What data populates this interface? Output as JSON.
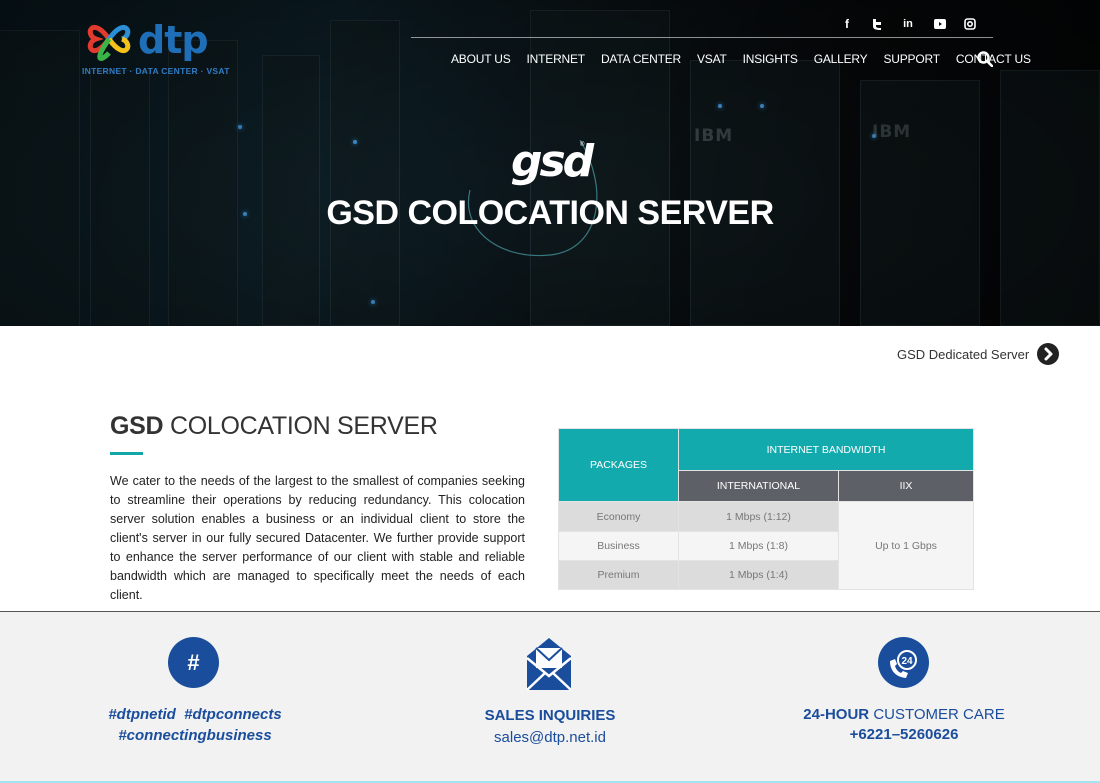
{
  "brand": {
    "logo_text": "dtp",
    "tagline": "INTERNET · DATA CENTER · VSAT",
    "colors": {
      "logo_blue": "#1f6fb8",
      "accent_teal": "#13a7a7",
      "footer_blue": "#1a4d9c"
    }
  },
  "social": [
    "facebook-icon",
    "twitter-icon",
    "linkedin-icon",
    "youtube-icon",
    "instagram-icon"
  ],
  "nav": {
    "items": [
      "ABOUT US",
      "INTERNET",
      "DATA CENTER",
      "VSAT",
      "INSIGHTS",
      "GALLERY",
      "SUPPORT",
      "CONTACT US"
    ],
    "search_icon": "search-icon"
  },
  "hero": {
    "product_logo": "gsd",
    "title": "GSD COLOCATION SERVER"
  },
  "subnav": {
    "next_label": "GSD Dedicated Server"
  },
  "section": {
    "title_bold": "GSD",
    "title_rest": "COLOCATION SERVER",
    "body": "We cater to the needs of the largest to the smallest of companies seeking to streamline their operations by reducing redundancy. This colocation server solution enables a business or an individual client to store the client's server in our fully secured Datacenter. We further provide support to enhance the server performance of our client with stable and reliable bandwidth which are managed to specifically meet the needs of each client."
  },
  "table": {
    "packages_header": "PACKAGES",
    "bandwidth_header": "INTERNET BANDWIDTH",
    "international_header": "INTERNATIONAL",
    "iix_header": "IIX",
    "rows": [
      {
        "package": "Economy",
        "international": "1 Mbps (1:12)"
      },
      {
        "package": "Business",
        "international": "1 Mbps (1:8)"
      },
      {
        "package": "Premium",
        "international": "1 Mbps (1:4)"
      }
    ],
    "iix_value": "Up to 1 Gbps"
  },
  "footer": {
    "hashtag_symbol": "#",
    "hashtags_line1": "#dtpnetid  #dtpconnects",
    "hashtags_line2": "#connectingbusiness",
    "sales_title": "SALES INQUIRIES",
    "sales_email": "sales@dtp.net.id",
    "care_bold": "24-HOUR",
    "care_rest": "CUSTOMER CARE",
    "care_phone": "+6221–5260626",
    "care_badge": "24"
  }
}
